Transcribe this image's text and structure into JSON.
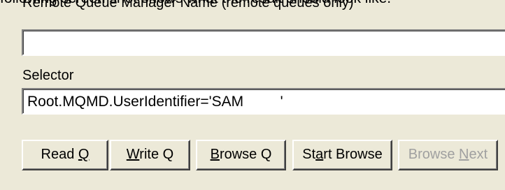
{
  "overlay_text": "following screen shot shows what the result should look like.",
  "remote_qmgr_label": "Remote Queue Manager Name (remote queues only)",
  "remote_qmgr_value": "",
  "selector_label": "Selector",
  "selector_value": "Root.MQMD.UserIdentifier='SAM         '",
  "buttons": {
    "read_q": {
      "pre": "Read ",
      "key": "Q",
      "post": ""
    },
    "write_q": {
      "pre": "",
      "key": "W",
      "post": "rite Q"
    },
    "browse_q": {
      "pre": "",
      "key": "B",
      "post": "rowse Q"
    },
    "start_browse": {
      "pre": "St",
      "key": "a",
      "post": "rt Browse"
    },
    "browse_next": {
      "pre": "Browse ",
      "key": "N",
      "post": "ext",
      "disabled": true
    }
  }
}
